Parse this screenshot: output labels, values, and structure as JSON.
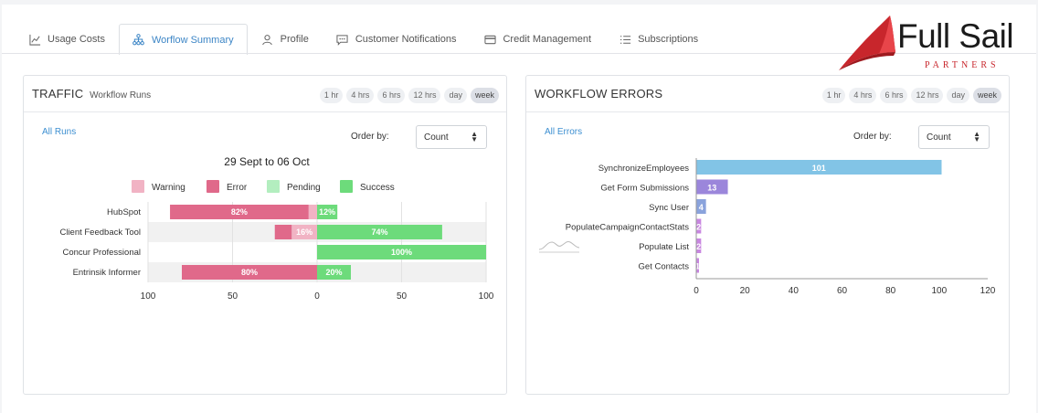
{
  "tabs": [
    {
      "label": "Usage Costs",
      "icon": "line-chart-icon",
      "active": false
    },
    {
      "label": "Worflow Summary",
      "icon": "workflow-icon",
      "active": true
    },
    {
      "label": "Profile",
      "icon": "user-icon",
      "active": false
    },
    {
      "label": "Customer Notifications",
      "icon": "chat-icon",
      "active": false
    },
    {
      "label": "Credit Management",
      "icon": "credit-card-icon",
      "active": false
    },
    {
      "label": "Subscriptions",
      "icon": "list-icon",
      "active": false
    }
  ],
  "logo": {
    "word": "Full Sail",
    "sub": "PARTNERS",
    "colors": {
      "red": "#c8262c",
      "dark": "#1b1b1b"
    }
  },
  "time_options": [
    "1 hr",
    "4 hrs",
    "6 hrs",
    "12 hrs",
    "day",
    "week"
  ],
  "traffic": {
    "title": "TRAFFIC",
    "subtitle": "Workflow Runs",
    "active_time": "week",
    "link": "All Runs",
    "order_label": "Order by:",
    "order_value": "Count"
  },
  "errors": {
    "title": "WORKFLOW ERRORS",
    "active_time": "week",
    "link": "All Errors",
    "order_label": "Order by:",
    "order_value": "Count"
  },
  "chart_data": [
    {
      "type": "bar",
      "orientation": "horizontal-diverging",
      "title": "29 Sept to 06 Oct",
      "legend": [
        {
          "name": "Warning",
          "color": "#f1b3c4"
        },
        {
          "name": "Error",
          "color": "#e0698a"
        },
        {
          "name": "Pending",
          "color": "#b3eebf"
        },
        {
          "name": "Success",
          "color": "#6ddb7b"
        }
      ],
      "categories": [
        "HubSpot",
        "Client Feedback Tool",
        "Concur Professional",
        "Entrinsik Informer"
      ],
      "series": [
        {
          "name": "Warning",
          "values": [
            5,
            15,
            0,
            0
          ]
        },
        {
          "name": "Error",
          "values": [
            82,
            10,
            0,
            80
          ]
        },
        {
          "name": "Success",
          "values": [
            12,
            74,
            100,
            20
          ]
        }
      ],
      "data_labels": {
        "Error": [
          "82%",
          "",
          "",
          "80%"
        ],
        "Warning": [
          "",
          "16%",
          "",
          ""
        ],
        "Success": [
          "12%",
          "74%",
          "100%",
          "20%"
        ]
      },
      "x_ticks": [
        "100",
        "50",
        "0",
        "50",
        "100"
      ],
      "xlim": [
        -100,
        100
      ],
      "grid": true
    },
    {
      "type": "bar",
      "orientation": "horizontal",
      "categories": [
        "SynchronizeEmployees",
        "Get Form Submissions",
        "Sync User",
        "PopulateCampaignContactStats",
        "Populate List",
        "Get Contacts"
      ],
      "values": [
        101,
        13,
        4,
        2,
        2,
        1
      ],
      "data_labels": [
        "101",
        "13",
        "4",
        "2",
        "2",
        "1"
      ],
      "colors": [
        "#82c4e6",
        "#9b86db",
        "#8aa3dc",
        "#c886e0",
        "#c886e0",
        "#c886e0"
      ],
      "x_ticks": [
        0,
        20,
        40,
        60,
        80,
        100,
        120
      ],
      "xlim": [
        0,
        120
      ],
      "grid": false
    }
  ]
}
